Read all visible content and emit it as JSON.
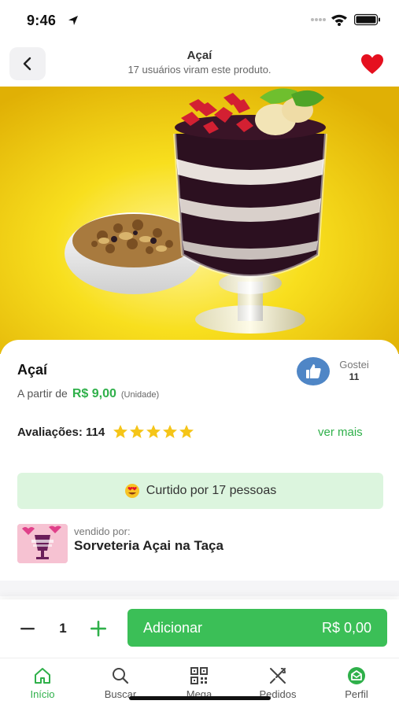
{
  "status_bar": {
    "time": "9:46"
  },
  "header": {
    "title": "Açaí",
    "subtitle": "17 usuários viram este produto."
  },
  "hero": {
    "icon": "acai-cup-image"
  },
  "product": {
    "name": "Açaí",
    "price_prefix": "A partir de",
    "price": "R$ 9,00",
    "price_unit": "(Unidade)",
    "like_label": "Gostei",
    "like_count": "11",
    "rating_label": "Avaliações: 114",
    "stars": 5,
    "see_more": "ver mais",
    "liked_by": "Curtido por 17 pessoas"
  },
  "seller": {
    "by_label": "vendido por:",
    "name": "Sorveteria Açai na Taça"
  },
  "add_bar": {
    "quantity": "1",
    "add_label": "Adicionar",
    "total": "R$ 0,00"
  },
  "tabs": [
    {
      "label": "Início",
      "icon": "home-icon",
      "active": true
    },
    {
      "label": "Buscar",
      "icon": "search-icon",
      "active": false
    },
    {
      "label": "Mega",
      "icon": "qr-code-icon",
      "active": false
    },
    {
      "label": "Pedidos",
      "icon": "utensils-icon",
      "active": false
    },
    {
      "label": "Perfil",
      "icon": "profile-icon",
      "active": false
    }
  ],
  "colors": {
    "accent": "#2fb04a",
    "button": "#3bbf57",
    "liked_bg": "#dcf5de",
    "like_button": "#4f86c6",
    "heart": "#e5101f",
    "star": "#f5c518"
  }
}
